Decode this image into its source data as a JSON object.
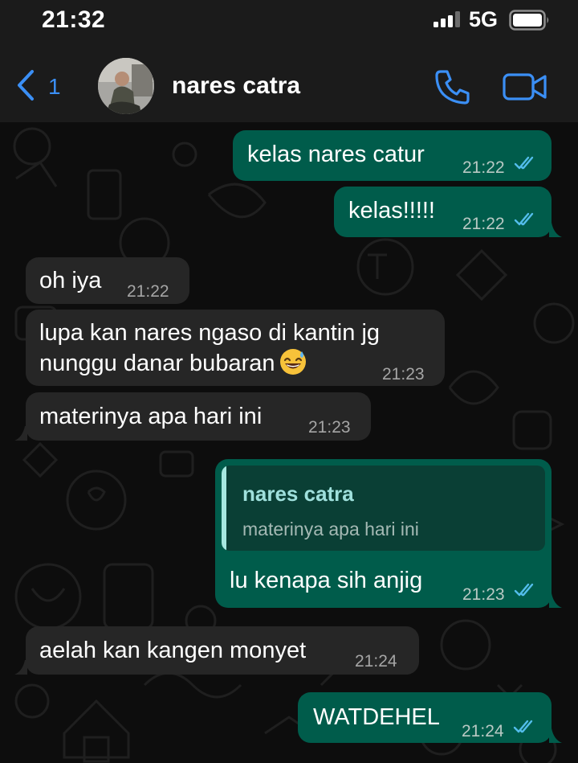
{
  "status_bar": {
    "time": "21:32",
    "network": "5G"
  },
  "header": {
    "back_count": "1",
    "contact_name": "nares catra"
  },
  "colors": {
    "accent": "#3b8ff5",
    "outgoing_bubble": "#005c4b",
    "incoming_bubble": "#262626",
    "read_ticks": "#53bdeb"
  },
  "messages": [
    {
      "direction": "out",
      "text": "kelas nares catur",
      "time": "21:22",
      "status": "read"
    },
    {
      "direction": "out",
      "text": "kelas!!!!!",
      "time": "21:22",
      "status": "read"
    },
    {
      "direction": "in",
      "text": "oh iya",
      "time": "21:22"
    },
    {
      "direction": "in",
      "text_line1": "lupa kan nares ngaso di kantin jg",
      "text_line2": "nunggu danar bubaran",
      "emoji": "grinning-sweat-emoji",
      "time": "21:23"
    },
    {
      "direction": "in",
      "text": "materinya apa hari ini",
      "time": "21:23"
    },
    {
      "direction": "out",
      "reply_to": {
        "name": "nares catra",
        "text": "materinya apa hari ini"
      },
      "text": "lu kenapa sih anjig",
      "time": "21:23",
      "status": "read"
    },
    {
      "direction": "in",
      "text": "aelah kan kangen monyet",
      "time": "21:24"
    },
    {
      "direction": "out",
      "text": "WATDEHEL",
      "time": "21:24",
      "status": "read"
    }
  ]
}
